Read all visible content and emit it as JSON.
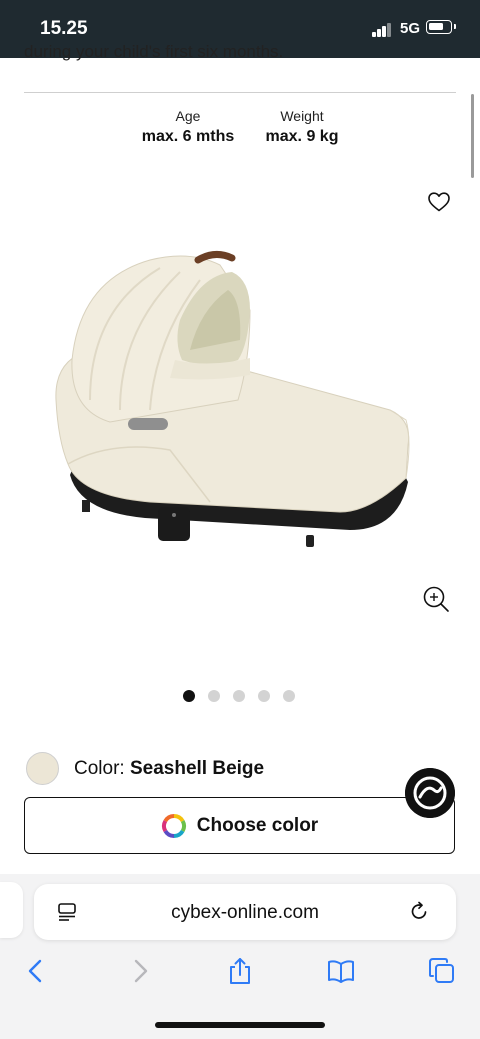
{
  "status_bar": {
    "time": "15.25",
    "network": "5G"
  },
  "description_cut": "during your child's first six months.",
  "specs": [
    {
      "label": "Age",
      "value": "max. 6 mths"
    },
    {
      "label": "Weight",
      "value": "max. 9 kg"
    }
  ],
  "product": {
    "image_name": "carry-cot-seashell-beige"
  },
  "gallery": {
    "total_slides": 5,
    "current_slide": 1
  },
  "color": {
    "prefix": "Color:",
    "name": "Seashell Beige",
    "swatch": "#ece6d6"
  },
  "choose_color_label": "Choose color",
  "browser": {
    "url": "cybex-online.com"
  },
  "icons": {
    "favorite": "heart-icon",
    "zoom": "zoom-in-icon",
    "chat": "chat-logo-icon",
    "color_wheel": "color-wheel-icon",
    "reader": "reader-mode-icon",
    "reload": "reload-icon",
    "back": "back-icon",
    "forward": "forward-icon",
    "share": "share-icon",
    "bookmarks": "bookmarks-icon",
    "tabs": "tabs-icon"
  },
  "colors": {
    "accent": "#2f7bf6",
    "status_bar": "#1f2a30",
    "text": "#111111"
  }
}
